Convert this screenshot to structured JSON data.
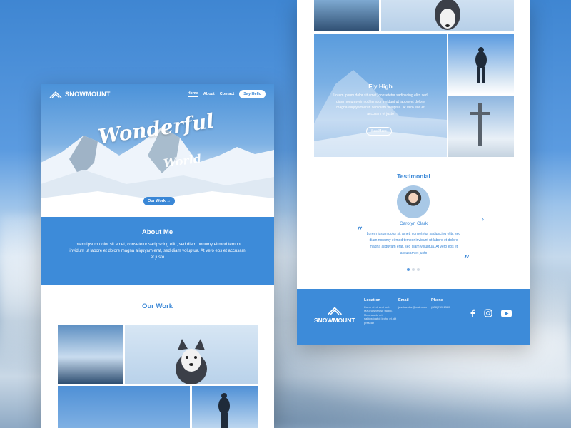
{
  "brand": {
    "name": "SNOWMOUNT",
    "accent": "#3d8bd9"
  },
  "nav": {
    "links": [
      "Home",
      "About",
      "Contact"
    ],
    "cta": "Say Hello"
  },
  "hero": {
    "title_line1": "Wonderful",
    "title_line2": "World",
    "button": "Our Work →"
  },
  "about": {
    "heading": "About Me",
    "text": "Lorem ipsum dolor sit amet, consetetur sadipscing elitr, sed diam nonumy eirmod tempor invidunt ut labore et dolore magna aliquyam erat, sed diam voluptua. At vero eos et accusam et justo"
  },
  "work": {
    "heading": "Our Work"
  },
  "feature": {
    "heading": "Fly High",
    "text": "Lorem ipsum dolor sit amet, consetetur sadipscing elitr, sed diam nonumy eirmod tempor invidunt ut labore et dolore magna aliquyam erat, sed diam voluptua. At vero eos et accusam et justo",
    "button": "See More"
  },
  "testimonial": {
    "heading": "Testimonial",
    "name": "Carolyn Clark",
    "text": "Lorem ipsum dolor sit amet, consetetur sadipscing elitr, sed diam nonumy eirmod tempor invidunt ut labore et dolore magna aliquyam erat, sed diam voluptua. At vero eos et accusam et justo"
  },
  "footer": {
    "location_label": "Location",
    "location_text": "Kuzm ei nit arot heil. Mauzu sheruse faciliti. Mauzu udo ret, sabiostidat di leohu et, dit prescan",
    "email_label": "Email",
    "email_text": "jessica.clar@mail.com",
    "phone_label": "Phone",
    "phone_text": "(808)749-1380",
    "social": [
      "facebook-icon",
      "instagram-icon",
      "youtube-icon"
    ]
  }
}
